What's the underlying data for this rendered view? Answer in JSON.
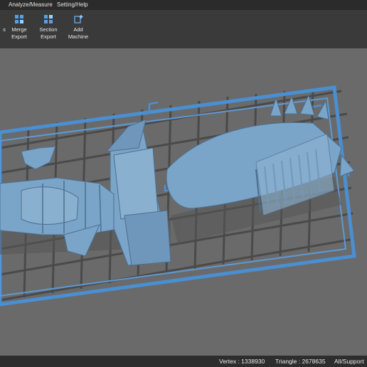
{
  "menubar": {
    "items": [
      "Analyze/Measure",
      "Setting/Help"
    ]
  },
  "toolbar": {
    "tools": [
      {
        "label": "Merge\nExport",
        "icon": "merge-export-icon"
      },
      {
        "label": "Section\nExport",
        "icon": "section-export-icon"
      },
      {
        "label": "Add\nMachine",
        "icon": "add-machine-icon"
      }
    ],
    "partial_left_label": "s"
  },
  "viewport": {
    "background": "#6a6a6a",
    "grid_color": "#4c4c4c",
    "frame_color": "#4a8fd2",
    "model_color": "#7aa4c8"
  },
  "statusbar": {
    "vertex": "Vertex : 1338930",
    "triangle": "Triangle : 2678635",
    "support": "All/Support"
  }
}
